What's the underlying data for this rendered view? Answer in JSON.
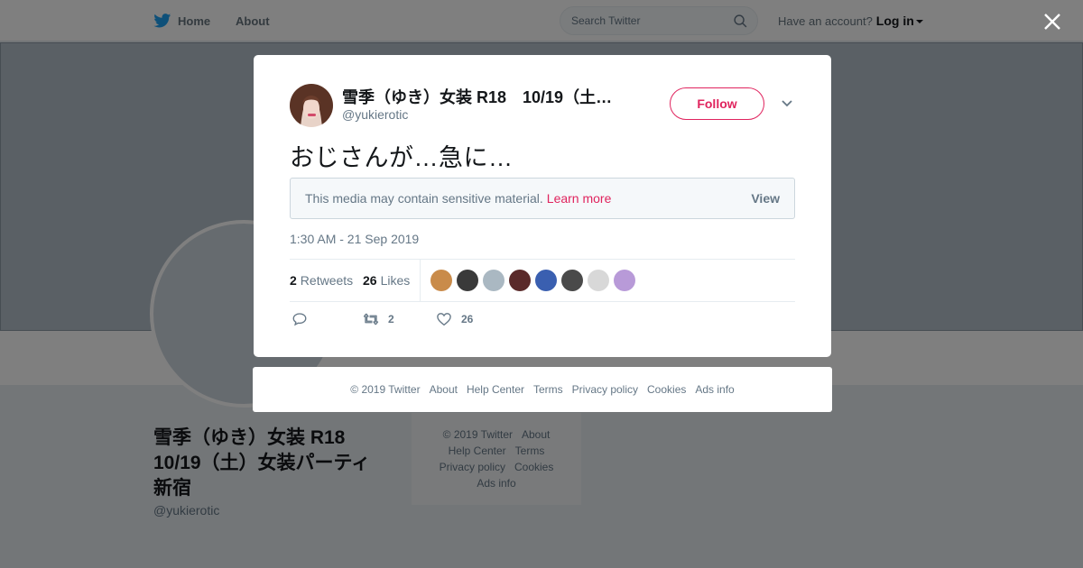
{
  "nav": {
    "home": "Home",
    "about": "About",
    "search_placeholder": "Search Twitter",
    "have_account": "Have an account?",
    "login": "Log in"
  },
  "profile": {
    "name": "雪季（ゆき）女装 R18　10/19（土）女装パーティ新宿",
    "handle": "@yukierotic"
  },
  "background_footer": [
    "© 2019 Twitter",
    "About",
    "Help Center",
    "Terms",
    "Privacy policy",
    "Cookies",
    "Ads info"
  ],
  "tweet": {
    "display_name": "雪季（ゆき）女装 R18　10/19（土…",
    "handle": "@yukierotic",
    "follow_label": "Follow",
    "text": "おじさんが…急に…",
    "sensitive_notice": "This media may contain sensitive material.",
    "learn_more": "Learn more",
    "view_label": "View",
    "timestamp": "1:30 AM - 21 Sep 2019",
    "retweets_count": "2",
    "retweets_label": "Retweets",
    "likes_count": "26",
    "likes_label": "Likes",
    "reply_count": "",
    "retweet_action_count": "2",
    "like_action_count": "26"
  },
  "likers": [
    "#c98b4a",
    "#3a3a3a",
    "#aab8c2",
    "#5a2a2a",
    "#3a5fb0",
    "#4a4a4a",
    "#d8d8d8",
    "#b89ad8"
  ],
  "modal_footer": [
    "© 2019 Twitter",
    "About",
    "Help Center",
    "Terms",
    "Privacy policy",
    "Cookies",
    "Ads info"
  ],
  "colors": {
    "accent": "#e0245e",
    "brand": "#1da1f2",
    "muted": "#657786"
  }
}
